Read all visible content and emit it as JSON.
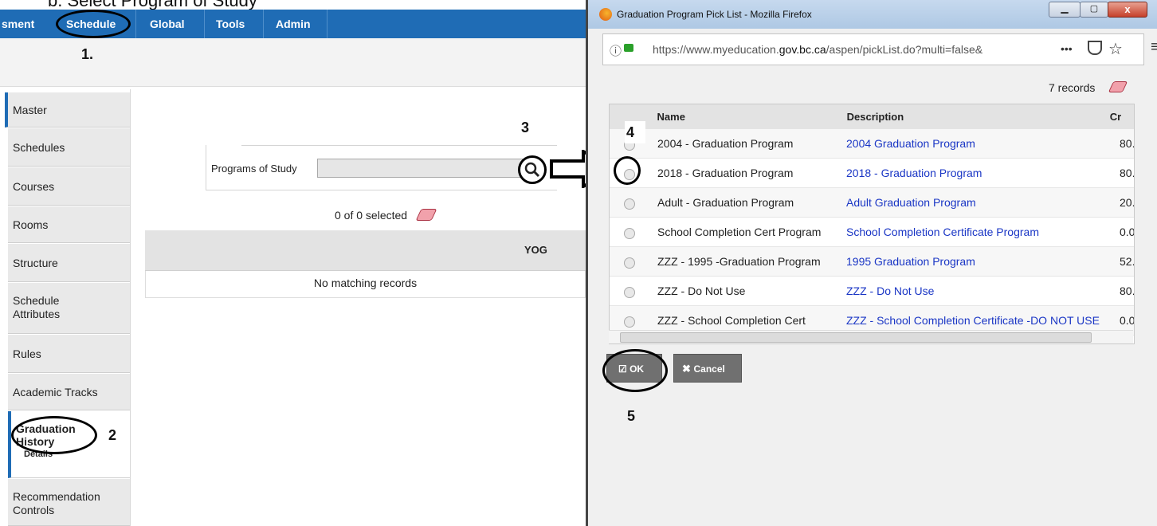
{
  "page_top_text": "b. Select Program of Study",
  "nav": {
    "items": [
      "sment",
      "Schedule",
      "Global",
      "Tools",
      "Admin"
    ]
  },
  "annotations": {
    "n1": "1.",
    "n2": "2",
    "n3": "3",
    "n4": "4",
    "n5": "5"
  },
  "sidebar": {
    "items": [
      "Master",
      "Schedules",
      "Courses",
      "Rooms",
      "Structure",
      "Schedule Attributes",
      "Rules",
      "Academic Tracks"
    ],
    "active_label": "Graduation History",
    "active_sub": "Details",
    "last_label": "Recommendation Controls"
  },
  "main": {
    "field_label": "Programs of Study",
    "selected_text": "0 of 0 selected",
    "col_header": "YOG",
    "empty_text": "No matching records"
  },
  "dialog": {
    "title": "Graduation Program Pick List - Mozilla Firefox",
    "url_prefix": "https://www.myeducation.",
    "url_domain": "gov.bc.ca",
    "url_suffix": "/aspen/pickList.do?multi=false&",
    "url_more": "•••",
    "records": "7 records",
    "headers": [
      "Name",
      "Description",
      "Cr"
    ],
    "rows": [
      {
        "name": "2004 - Graduation Program",
        "desc": "2004 Graduation Program",
        "cr": "80."
      },
      {
        "name": "2018 - Graduation Program",
        "desc": "2018 - Graduation Program",
        "cr": "80."
      },
      {
        "name": "Adult - Graduation Program",
        "desc": "Adult Graduation Program",
        "cr": "20."
      },
      {
        "name": "School Completion Cert Program",
        "desc": "School Completion Certificate Program",
        "cr": "0.0"
      },
      {
        "name": "ZZZ - 1995 -Graduation Program",
        "desc": "1995 Graduation Program",
        "cr": "52."
      },
      {
        "name": "ZZZ - Do Not Use",
        "desc": "ZZZ - Do Not Use",
        "cr": "80."
      },
      {
        "name": "ZZZ - School Completion Cert",
        "desc": "ZZZ - School Completion Certificate -DO NOT USE",
        "cr": "0.0"
      }
    ],
    "ok_label": "OK",
    "cancel_label": "Cancel"
  }
}
